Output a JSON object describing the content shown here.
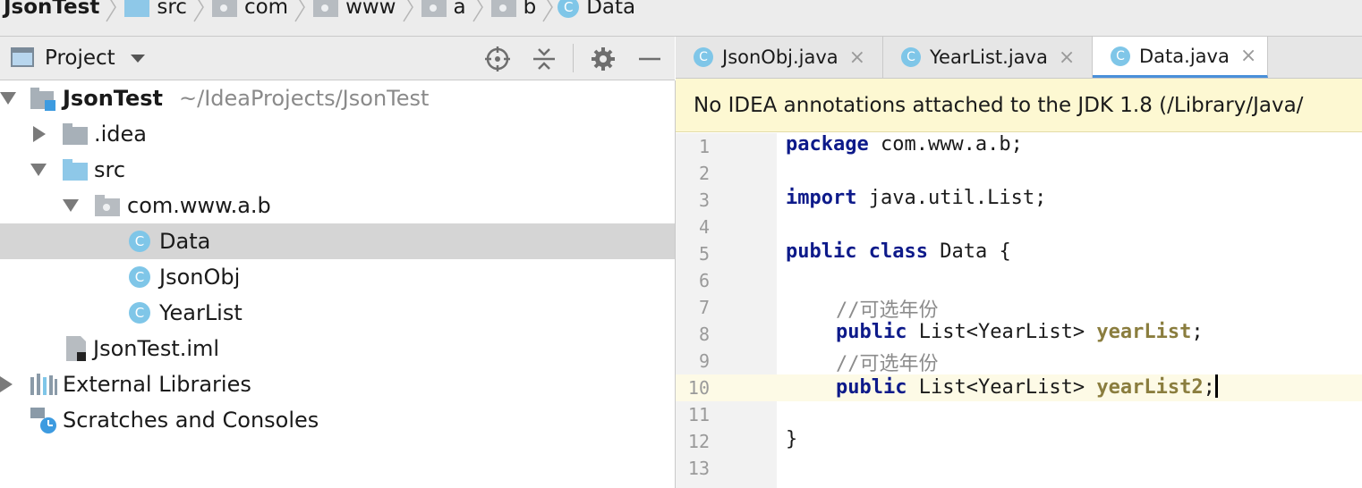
{
  "breadcrumb": {
    "project": "JsonTest",
    "items": [
      "src",
      "com",
      "www",
      "a",
      "b"
    ],
    "file": "Data"
  },
  "project_panel": {
    "title": "Project",
    "icons": [
      "locate-icon",
      "collapse-all-icon",
      "gear-icon",
      "minimize-icon"
    ]
  },
  "tree": {
    "root_name": "JsonTest",
    "root_path": "~/IdeaProjects/JsonTest",
    "idea": ".idea",
    "src": "src",
    "package": "com.www.a.b",
    "classes": [
      "Data",
      "JsonObj",
      "YearList"
    ],
    "iml": "JsonTest.iml",
    "external": "External Libraries",
    "scratches": "Scratches and Consoles"
  },
  "editor": {
    "tabs": [
      {
        "label": "JsonObj.java",
        "close": "×"
      },
      {
        "label": "YearList.java",
        "close": "×"
      },
      {
        "label": "Data.java",
        "close": "×"
      }
    ],
    "active_tab": 2,
    "notice": "No IDEA annotations attached to the JDK 1.8 (/Library/Java/",
    "line_numbers": [
      "1",
      "2",
      "3",
      "4",
      "5",
      "6",
      "7",
      "8",
      "9",
      "10",
      "11",
      "12",
      "13"
    ],
    "code": {
      "kw_package": "package",
      "pkg_rest": " com.www.a.b;",
      "kw_import": "import",
      "import_rest": " java.util.List;",
      "kw_public": "public",
      "kw_class": "class",
      "class_rest": " Data {",
      "comment": "//可选年份",
      "type": " List<YearList> ",
      "field1": "yearList",
      "field2": "yearList2",
      "semi": ";",
      "close_brace": "}"
    },
    "current_line": 10
  },
  "colors": {
    "keyword": "#0d1a8a",
    "field": "#8a7d3e",
    "comment": "#8c8c8c",
    "class_icon": "#7fc6e8",
    "notice_bg": "#fdf8d2"
  }
}
